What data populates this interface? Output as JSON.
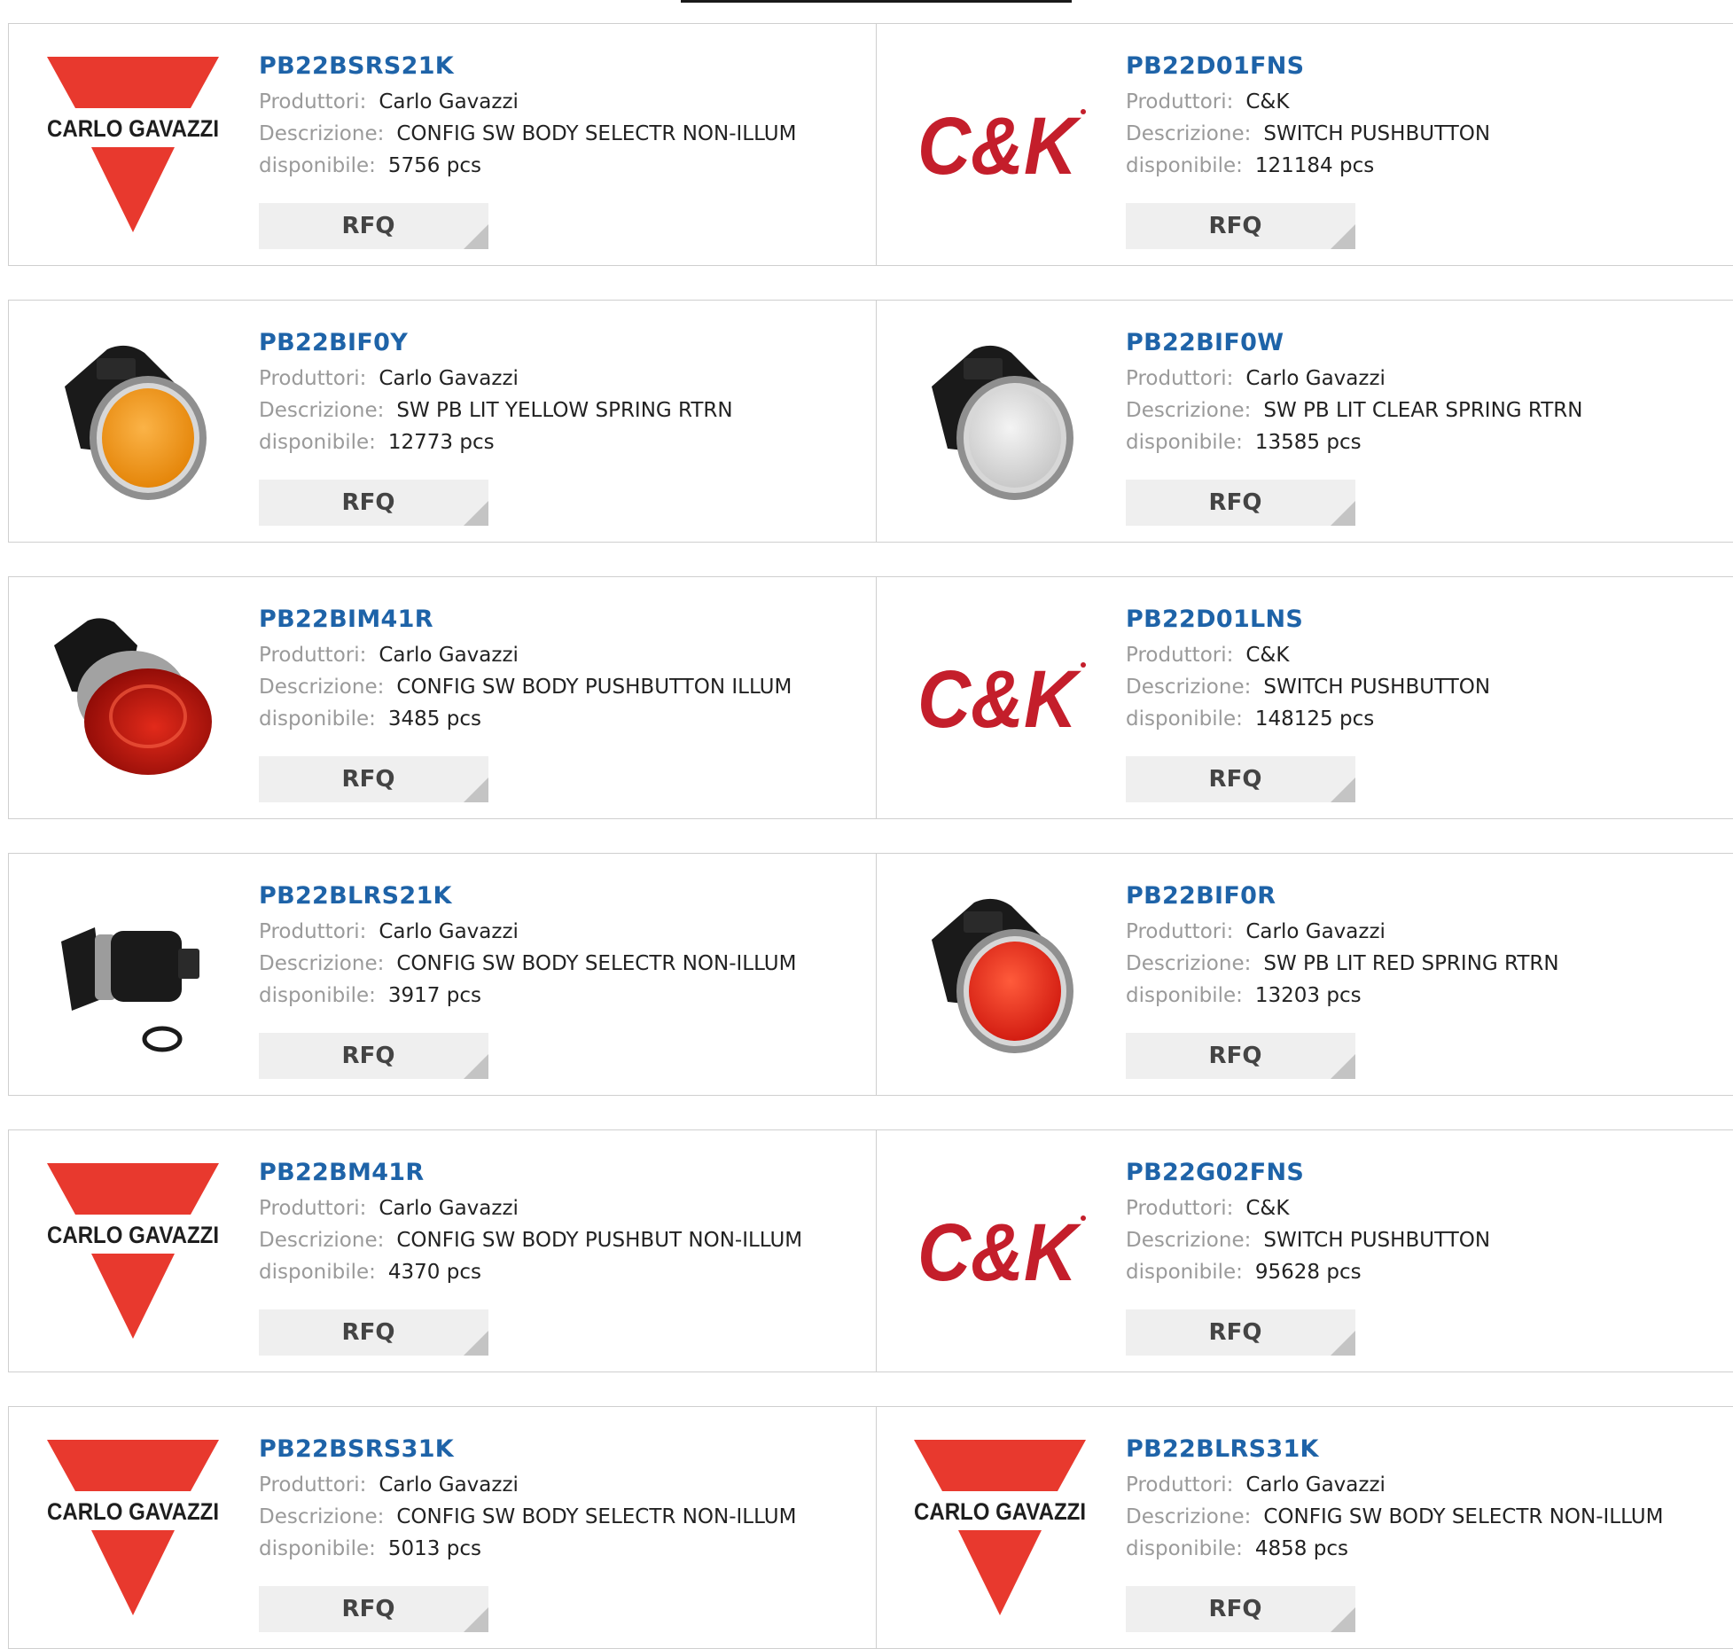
{
  "labels": {
    "manufacturer": "Produttori:",
    "description": "Descrizione:",
    "available": "disponibile:"
  },
  "rfq_label": "RFQ",
  "brand_text": {
    "carlo": "CARLO GAVAZZI",
    "ck": "C&K"
  },
  "colors": {
    "part_link": "#1e63a8",
    "carlo_red": "#e8392e",
    "ck_red": "#c41e2b"
  },
  "products": [
    {
      "part": "PB22BSRS21K",
      "manufacturer": "Carlo Gavazzi",
      "description": "CONFIG SW BODY SELECTR NON-ILLUM",
      "available": "5756 pcs",
      "image": "carlo-gavazzi-logo"
    },
    {
      "part": "PB22D01FNS",
      "manufacturer": "C&K",
      "description": "SWITCH PUSHBUTTON",
      "available": "121184 pcs",
      "image": "ck-logo"
    },
    {
      "part": "PB22BIF0Y",
      "manufacturer": "Carlo Gavazzi",
      "description": "SW PB LIT YELLOW SPRING RTRN",
      "available": "12773 pcs",
      "image": "pushbutton-yellow"
    },
    {
      "part": "PB22BIF0W",
      "manufacturer": "Carlo Gavazzi",
      "description": "SW PB LIT CLEAR SPRING RTRN",
      "available": "13585 pcs",
      "image": "pushbutton-clear"
    },
    {
      "part": "PB22BIM41R",
      "manufacturer": "Carlo Gavazzi",
      "description": "CONFIG SW BODY PUSHBUTTON ILLUM",
      "available": "3485 pcs",
      "image": "mushroom-red"
    },
    {
      "part": "PB22D01LNS",
      "manufacturer": "C&K",
      "description": "SWITCH PUSHBUTTON",
      "available": "148125 pcs",
      "image": "ck-logo"
    },
    {
      "part": "PB22BLRS21K",
      "manufacturer": "Carlo Gavazzi",
      "description": "CONFIG SW BODY SELECTR NON-ILLUM",
      "available": "3917 pcs",
      "image": "selector-switch"
    },
    {
      "part": "PB22BIF0R",
      "manufacturer": "Carlo Gavazzi",
      "description": "SW PB LIT RED SPRING RTRN",
      "available": "13203 pcs",
      "image": "pushbutton-red"
    },
    {
      "part": "PB22BM41R",
      "manufacturer": "Carlo Gavazzi",
      "description": "CONFIG SW BODY PUSHBUT NON-ILLUM",
      "available": "4370 pcs",
      "image": "carlo-gavazzi-logo"
    },
    {
      "part": "PB22G02FNS",
      "manufacturer": "C&K",
      "description": "SWITCH PUSHBUTTON",
      "available": "95628 pcs",
      "image": "ck-logo"
    },
    {
      "part": "PB22BSRS31K",
      "manufacturer": "Carlo Gavazzi",
      "description": "CONFIG SW BODY SELECTR NON-ILLUM",
      "available": "5013 pcs",
      "image": "carlo-gavazzi-logo"
    },
    {
      "part": "PB22BLRS31K",
      "manufacturer": "Carlo Gavazzi",
      "description": "CONFIG SW BODY SELECTR NON-ILLUM",
      "available": "4858 pcs",
      "image": "carlo-gavazzi-logo"
    }
  ]
}
